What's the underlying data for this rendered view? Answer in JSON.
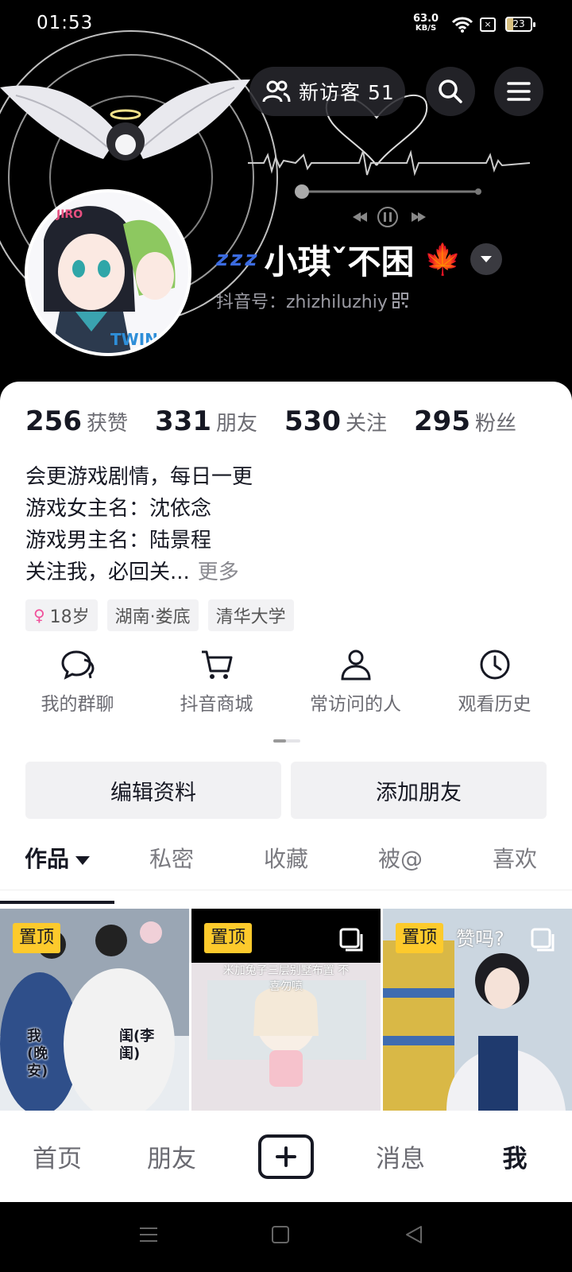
{
  "status_bar": {
    "time": "01:53",
    "net_speed_value": "63.0",
    "net_speed_unit": "KB/S",
    "battery": "23"
  },
  "header": {
    "visitors_label": "新访客 51",
    "icons": [
      "visitors-icon",
      "search-icon",
      "menu-icon"
    ]
  },
  "profile": {
    "nickname": "小琪ˇ不困",
    "zzz": "z z z",
    "nickname_emoji": "🍁",
    "douyin_id": "抖音号：zhizhiluzhiy"
  },
  "stats": [
    {
      "value": "256",
      "label": "获赞"
    },
    {
      "value": "331",
      "label": "朋友"
    },
    {
      "value": "530",
      "label": "关注"
    },
    {
      "value": "295",
      "label": "粉丝"
    }
  ],
  "bio": {
    "lines": [
      "会更游戏剧情，每日一更",
      "游戏女主名：沈依念",
      "游戏男主名：陆景程",
      "关注我，必回关..."
    ],
    "more": "更多"
  },
  "tags": [
    "18岁",
    "湖南·娄底",
    "清华大学"
  ],
  "shortcuts": [
    {
      "label": "我的群聊",
      "icon": "group-chat-icon"
    },
    {
      "label": "抖音商城",
      "icon": "cart-icon"
    },
    {
      "label": "常访问的人",
      "icon": "person-icon"
    },
    {
      "label": "观看历史",
      "icon": "clock-icon"
    }
  ],
  "actions": {
    "edit": "编辑资料",
    "add_friend": "添加朋友"
  },
  "tabs": [
    "作品",
    "私密",
    "收藏",
    "被@",
    "喜欢"
  ],
  "grid": {
    "pin_label": "置顶",
    "items": [
      {
        "caption_a": "我(晚安)",
        "caption_b": "闺(李闺)"
      },
      {
        "caption": "米加兔子三层别墅布置 不喜勿喷"
      },
      {
        "caption": "赞吗?"
      }
    ]
  },
  "bottom_nav": [
    "首页",
    "朋友",
    "消息",
    "我"
  ],
  "colors": {
    "pin": "#fdca2c",
    "female": "#f0509a",
    "text": "#161823"
  }
}
